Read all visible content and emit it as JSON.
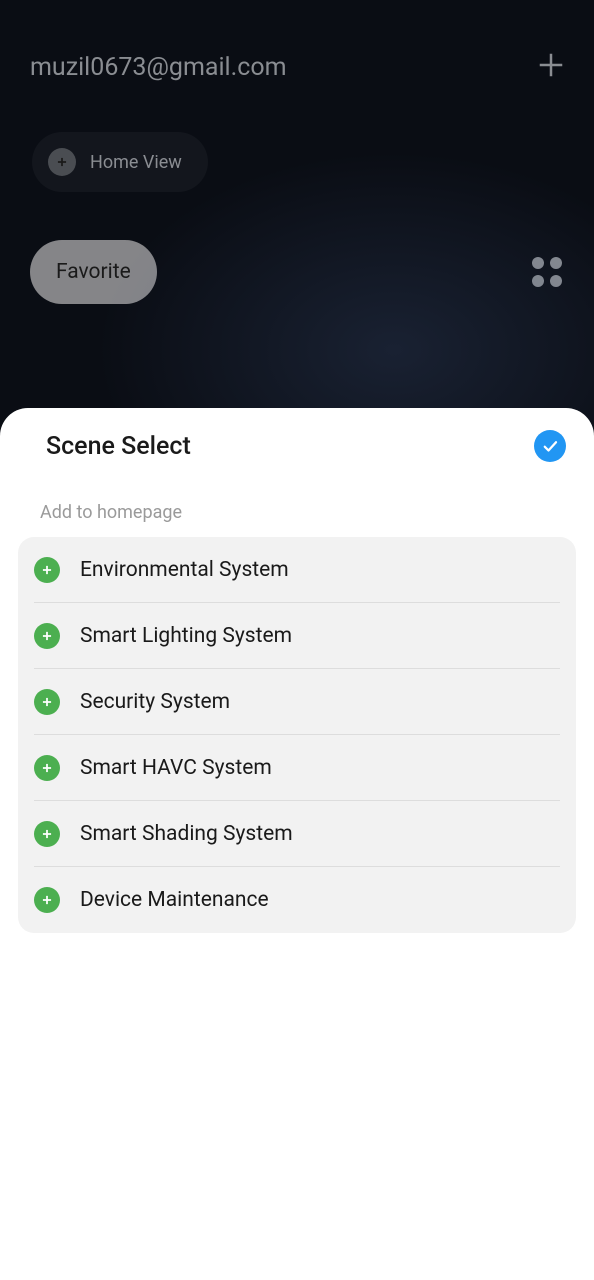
{
  "header": {
    "email": "muzil0673@gmail.com"
  },
  "home_view": {
    "label": "Home View"
  },
  "tabs": {
    "favorite": "Favorite"
  },
  "sheet": {
    "title": "Scene Select",
    "subtitle": "Add to homepage",
    "items": [
      {
        "label": "Environmental System"
      },
      {
        "label": "Smart Lighting System"
      },
      {
        "label": "Security  System"
      },
      {
        "label": "Smart HAVC System"
      },
      {
        "label": "Smart Shading System"
      },
      {
        "label": "Device Maintenance"
      }
    ]
  }
}
